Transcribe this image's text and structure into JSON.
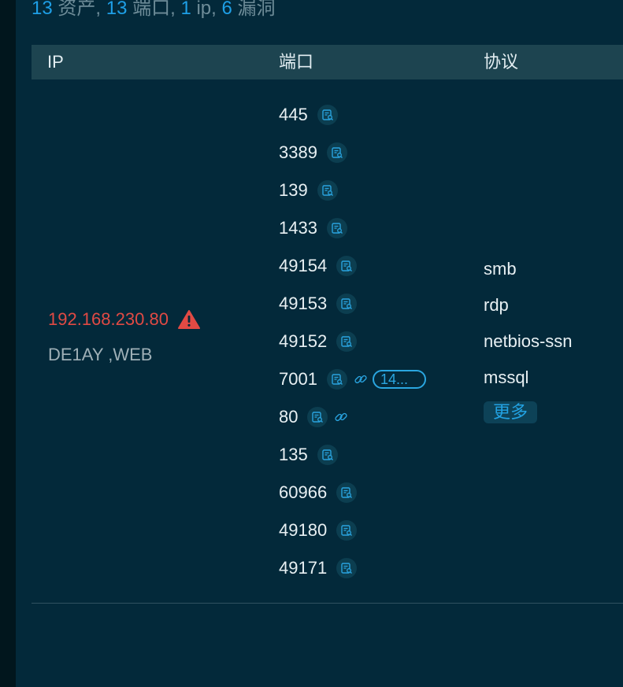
{
  "summary": {
    "assets_count": "13",
    "assets_label": " 资产, ",
    "ports_count": "13",
    "ports_label": " 端口, ",
    "ip_count": "1",
    "ip_label": " ip, ",
    "vuln_count": "6",
    "vuln_label": " 漏洞"
  },
  "table": {
    "headers": {
      "ip": "IP",
      "port": "端口",
      "protocol": "协议"
    }
  },
  "row": {
    "ip": "192.168.230.80",
    "hostnames": "DE1AY ,WEB",
    "ports": [
      "445",
      "3389",
      "139",
      "1433",
      "49154",
      "49153",
      "49152",
      "7001",
      "80",
      "135",
      "60966",
      "49180",
      "49171"
    ],
    "port_7001_tag": "14...",
    "protocols": [
      "smb",
      "rdp",
      "netbios-ssn",
      "mssql"
    ],
    "more_label": "更多"
  },
  "colors": {
    "accent": "#1e9fe6",
    "danger": "#e14a44",
    "header_bg": "#1d4450",
    "panel_bg": "#03293a"
  },
  "icons": {
    "scan": "scan-detail-icon",
    "link": "link-icon",
    "warning": "warning-icon"
  }
}
